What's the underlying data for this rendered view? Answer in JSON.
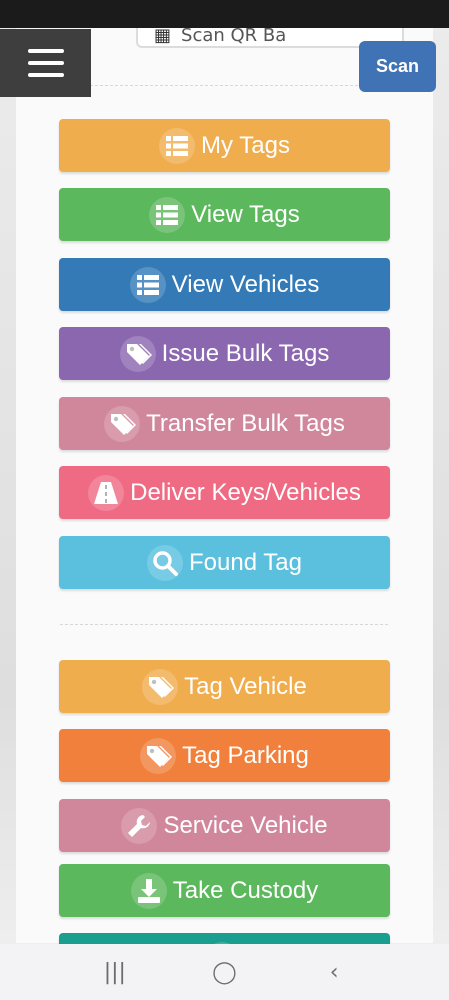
{
  "header": {
    "qr_label": "Scan QR Ba",
    "scan_label": "Scan"
  },
  "buttons": [
    {
      "label": "My Tags",
      "color": "#f0ad4e",
      "icon": "list-icon"
    },
    {
      "label": "View Tags",
      "color": "#5cb85c",
      "icon": "list-icon"
    },
    {
      "label": "View Vehicles",
      "color": "#337ab7",
      "icon": "list-icon"
    },
    {
      "label": "Issue Bulk Tags",
      "color": "#8b67b0",
      "icon": "tags-icon"
    },
    {
      "label": "Transfer Bulk Tags",
      "color": "#d0879b",
      "icon": "tags-icon"
    },
    {
      "label": "Deliver Keys/Vehicles",
      "color": "#ef6b83",
      "icon": "road-icon"
    },
    {
      "label": "Found Tag",
      "color": "#5bc0de",
      "icon": "search-icon"
    },
    {
      "label": "Tag Vehicle",
      "color": "#f0ad4e",
      "icon": "tags-icon"
    },
    {
      "label": "Tag Parking",
      "color": "#f0803c",
      "icon": "tags-icon"
    },
    {
      "label": "Service Vehicle",
      "color": "#d0879b",
      "icon": "wrench-icon"
    },
    {
      "label": "Take Custody",
      "color": "#5cb85c",
      "icon": "download-icon"
    },
    {
      "label": "",
      "color": "#1a9e8f",
      "icon": "list-icon"
    }
  ],
  "navbar": {
    "recent": "|||",
    "home": "◯",
    "back": "‹"
  }
}
